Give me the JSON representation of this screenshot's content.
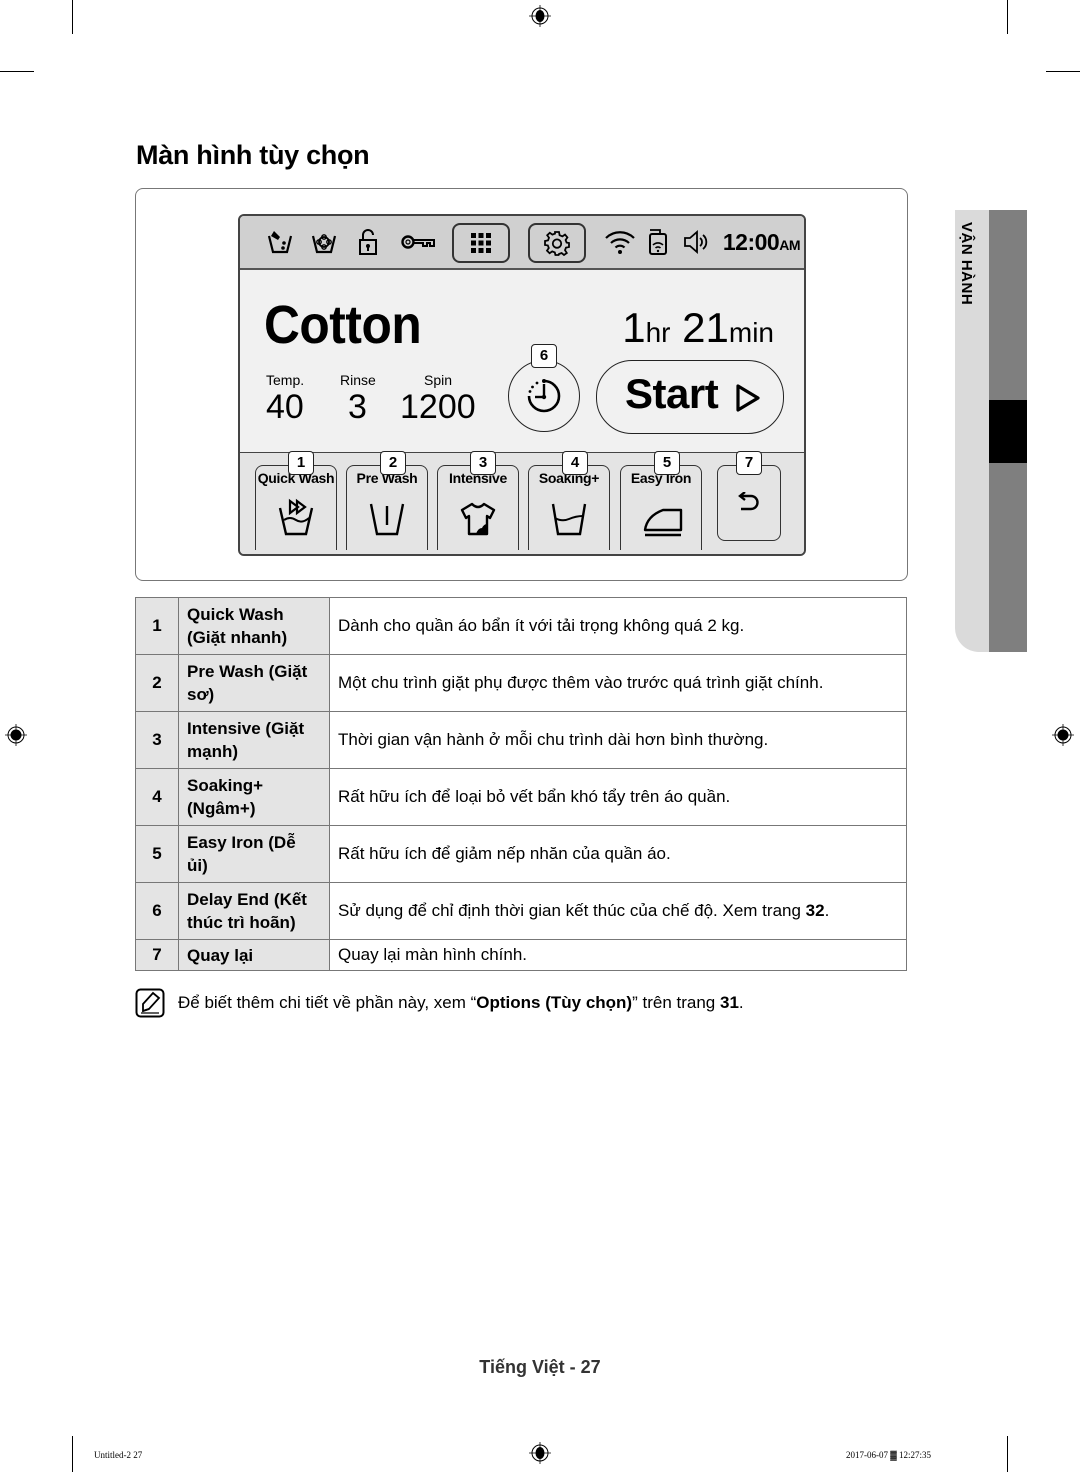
{
  "page": {
    "title": "Màn hình tùy chọn",
    "side_tab": "VẬN HÀNH",
    "footer": "Tiếng Việt - 27",
    "print_slug_left": "Untitled-2   27",
    "print_slug_right": "2017-06-07   ▓ 12:27:35"
  },
  "device_screen": {
    "status_bar": {
      "icons": [
        "detergent-icon",
        "softener-icon",
        "child-lock-open-icon",
        "key-icon",
        "menu-grid-icon",
        "settings-gear-icon",
        "wifi-icon",
        "smart-control-icon",
        "volume-icon"
      ],
      "time": "12:00",
      "ampm": "AM"
    },
    "cycle_name": "Cotton",
    "time_remaining": {
      "hours": "1",
      "hours_unit": "hr",
      "minutes": "21",
      "minutes_unit": "min"
    },
    "params": [
      {
        "label": "Temp.",
        "value": "40"
      },
      {
        "label": "Rinse",
        "value": "3"
      },
      {
        "label": "Spin",
        "value": "1200"
      }
    ],
    "delay_end_badge": "6",
    "start_label": "Start",
    "options": [
      {
        "badge": "1",
        "label": "Quick Wash",
        "icon": "quick-wash-icon"
      },
      {
        "badge": "2",
        "label": "Pre Wash",
        "icon": "pre-wash-icon"
      },
      {
        "badge": "3",
        "label": "Intensive",
        "icon": "intensive-icon"
      },
      {
        "badge": "4",
        "label": "Soaking+",
        "icon": "soaking-icon"
      },
      {
        "badge": "5",
        "label": "Easy Iron",
        "icon": "easy-iron-icon"
      }
    ],
    "back_badge": "7"
  },
  "table": {
    "rows": [
      {
        "num": "1",
        "name": "Quick Wash (Giặt nhanh)",
        "desc": "Dành cho quần áo bẩn ít với tải trọng không quá 2 kg."
      },
      {
        "num": "2",
        "name": "Pre Wash (Giặt sơ)",
        "desc": "Một chu trình giặt phụ được thêm vào trước quá trình giặt chính."
      },
      {
        "num": "3",
        "name": "Intensive (Giặt mạnh)",
        "desc": "Thời gian vận hành ở mỗi chu trình dài hơn bình thường."
      },
      {
        "num": "4",
        "name": "Soaking+ (Ngâm+)",
        "desc": "Rất hữu ích để loại bỏ vết bẩn khó tẩy trên áo quần."
      },
      {
        "num": "5",
        "name": "Easy Iron (Dễ ủi)",
        "desc": "Rất hữu ích để giảm nếp nhăn của quần áo."
      },
      {
        "num": "6",
        "name": "Delay End (Kết thúc trì hoãn)",
        "desc_pre": "Sử dụng để chỉ định thời gian kết thúc của chế độ. Xem trang ",
        "desc_bold": "32",
        "desc_post": "."
      },
      {
        "num": "7",
        "name": "Quay lại",
        "desc": "Quay lại màn hình chính."
      }
    ]
  },
  "note": {
    "pre": "Để biết thêm chi tiết về phần này, xem “",
    "bold": "Options (Tùy chọn)",
    "mid": "” trên trang ",
    "page": "31",
    "post": "."
  }
}
